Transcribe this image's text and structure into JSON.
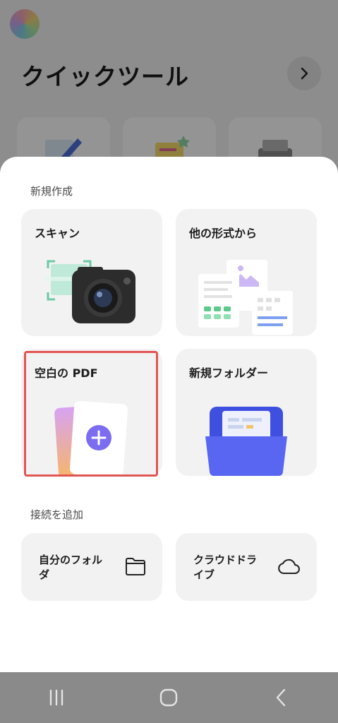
{
  "background": {
    "title": "クイックツール"
  },
  "sheet": {
    "section_new": "新規作成",
    "cards": {
      "scan": "スキャン",
      "other_format": "他の形式から",
      "blank_pdf": "空白の PDF",
      "new_folder": "新規フォルダー"
    },
    "section_connect": "接続を追加",
    "connections": {
      "my_folder_line1": "自分のフォル",
      "my_folder_line2": "ダ",
      "cloud_drive_line1": "クラウドドラ",
      "cloud_drive_line2": "イブ"
    }
  },
  "colors": {
    "accent_purple": "#7b6cf0",
    "highlight_red": "#e25555",
    "folder_blue": "#4f5ff0",
    "scan_green": "#7fd3b4"
  },
  "icons": [
    "arrow-right-icon",
    "camera-icon",
    "folder-icon",
    "cloud-icon",
    "plus-icon",
    "recent-apps-icon",
    "home-icon",
    "back-icon"
  ]
}
